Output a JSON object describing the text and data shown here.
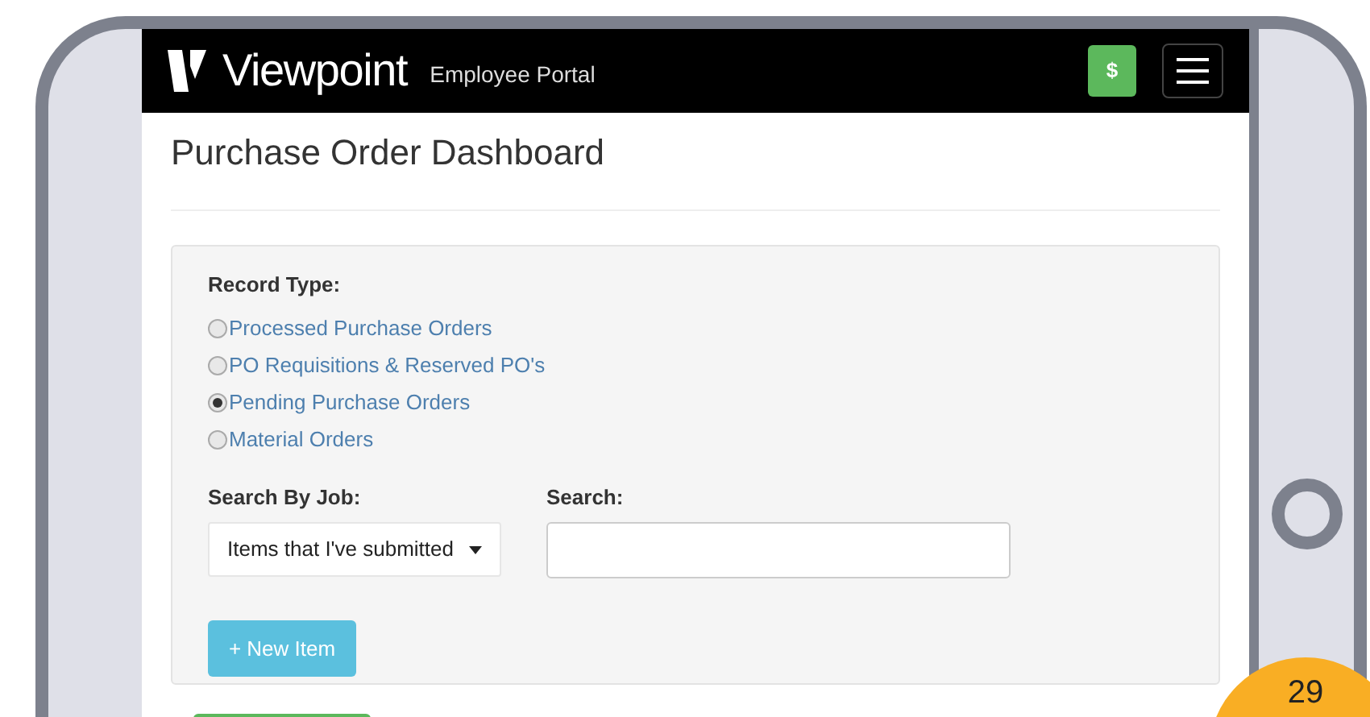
{
  "header": {
    "brand": "Viewpoint",
    "suffix": "Employee Portal",
    "money_button": "$"
  },
  "title": "Purchase Order Dashboard",
  "filters": {
    "record_type_label": "Record Type:",
    "record_types": [
      {
        "label": "Processed Purchase Orders",
        "selected": false
      },
      {
        "label": "PO Requisitions & Reserved PO's",
        "selected": false
      },
      {
        "label": "Pending Purchase Orders",
        "selected": true
      },
      {
        "label": "Material Orders",
        "selected": false
      }
    ],
    "job_label": "Search By Job:",
    "job_value": "Items that I've submitted",
    "search_label": "Search:",
    "new_button": "+ New Item"
  },
  "page_badge": "29"
}
